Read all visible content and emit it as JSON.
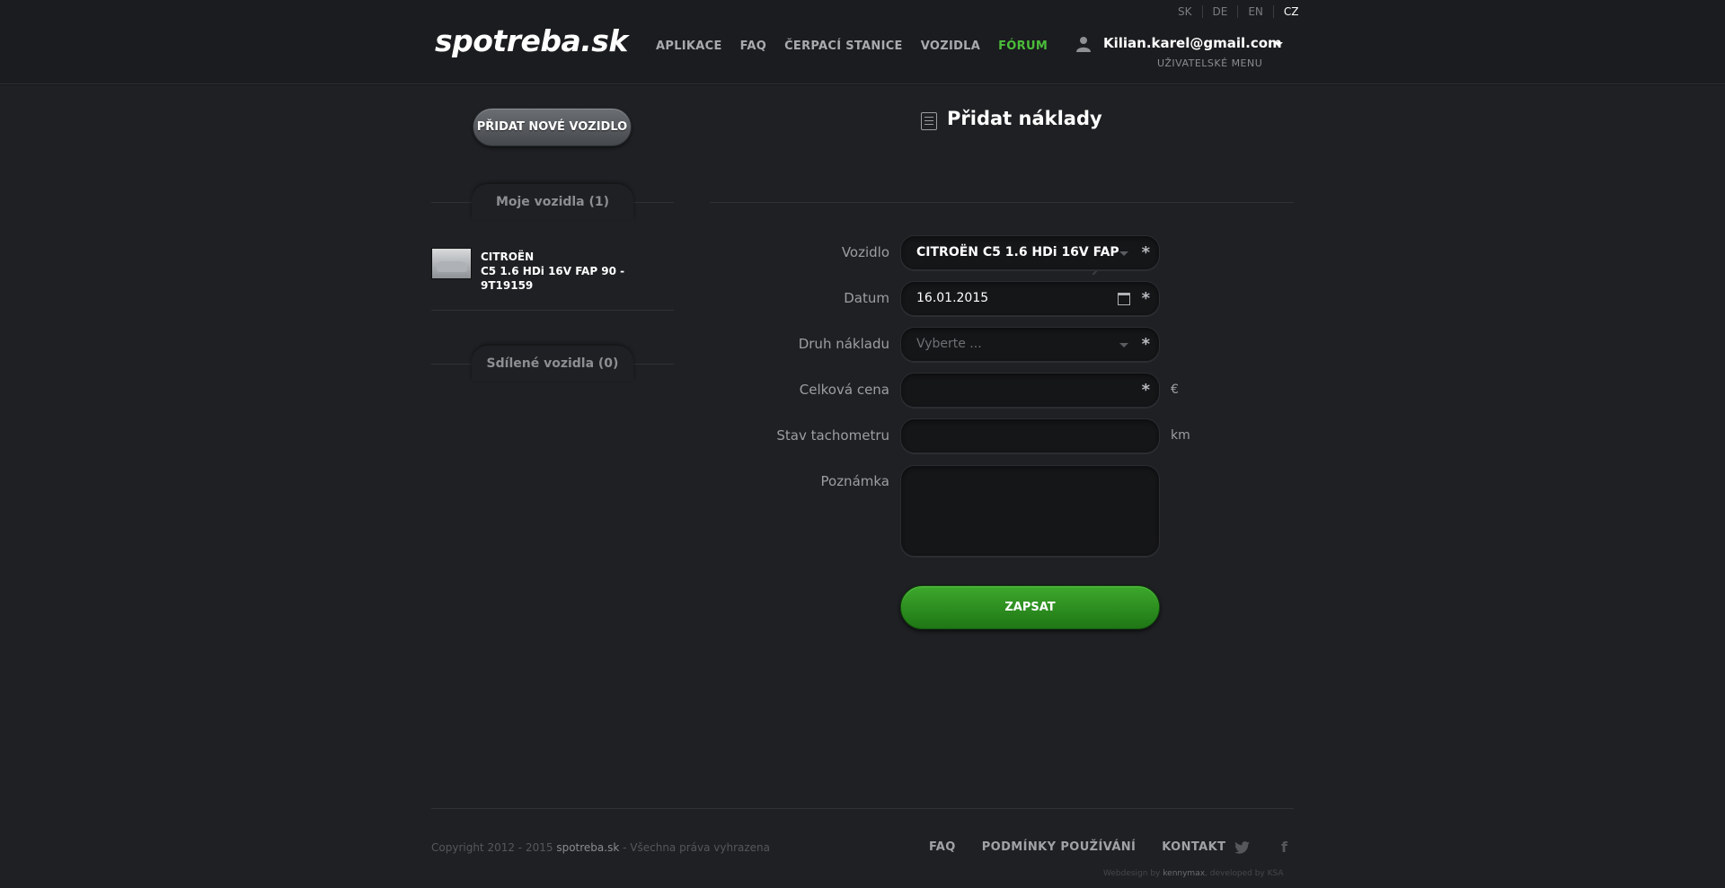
{
  "header": {
    "logo": "spotreba.sk",
    "nav": [
      {
        "label": "APLIKACE"
      },
      {
        "label": "FAQ"
      },
      {
        "label": "ČERPACÍ STANICE"
      },
      {
        "label": "VOZIDLA"
      },
      {
        "label": "FÓRUM"
      }
    ],
    "languages": [
      "SK",
      "DE",
      "EN",
      "CZ"
    ],
    "active_language": "CZ",
    "user_email": "Kilian.karel@gmail.com",
    "user_menu": "UŽIVATELSKÉ MENU"
  },
  "sidebar": {
    "add_vehicle": "PŘIDAT NOVÉ VOZIDLO",
    "my_vehicles": "Moje vozidla (1)",
    "vehicle": {
      "line1": "CITROËN",
      "line2": "C5 1.6 HDi 16V FAP 90 -",
      "line3": "9T19159"
    },
    "shared_vehicles": "Sdílené vozidla (0)"
  },
  "main": {
    "title": "Přidat náklady",
    "form": {
      "vehicle_label": "Vozidlo",
      "vehicle_value": "CITROËN C5 1.6 HDi 16V FAP",
      "date_label": "Datum",
      "date_value": "16.01.2015",
      "cost_type_label": "Druh nákladu",
      "cost_type_placeholder": "Vyberte ...",
      "total_price_label": "Celková cena",
      "total_price_unit": "€",
      "odometer_label": "Stav tachometru",
      "odometer_unit": "km",
      "note_label": "Poznámka",
      "required_mark": "*",
      "submit": "ZAPSAT"
    }
  },
  "footer": {
    "copyright_prefix": "Copyright 2012 - 2015",
    "copyright_site": "spotreba.sk",
    "copyright_suffix": "- Všechna práva vyhrazena",
    "links": [
      "FAQ",
      "PODMÍNKY POUŽÍVÁNÍ",
      "KONTAKT"
    ],
    "credits_webdesign": "Webdesign by",
    "credits_designer": "kennymax",
    "credits_developed": ", developed by KSA"
  }
}
